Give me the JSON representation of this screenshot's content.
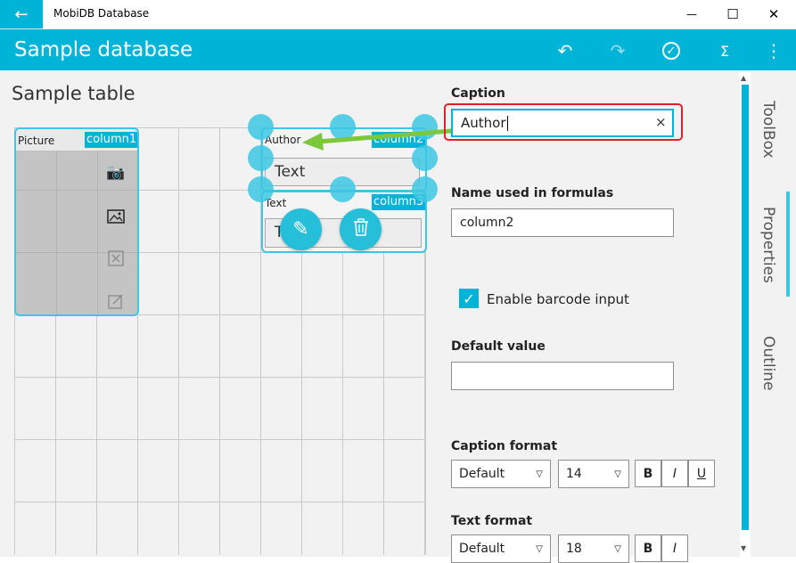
{
  "window": {
    "app_title": "MobiDB Database",
    "back_icon": "←",
    "minimize_icon": "—",
    "maximize_icon": "☐",
    "close_icon": "✕"
  },
  "header": {
    "title": "Sample database",
    "undo_icon": "↶",
    "redo_icon": "↷",
    "check_icon": "✓",
    "formula_icon": "Σ",
    "more_icon": "⋮",
    "color": "#00b4d8"
  },
  "table": {
    "title": "Sample table",
    "column1": {
      "label": "Picture",
      "tag": "column1"
    },
    "column2": {
      "label": "Author",
      "tag": "column2",
      "field_text": "Text"
    },
    "column3": {
      "label": "Text",
      "tag": "column3",
      "field_text": "T"
    },
    "edit_icon": "✎",
    "delete_icon": "🗑"
  },
  "properties": {
    "caption_label": "Caption",
    "caption_value": "Author",
    "clear_icon": "×",
    "formula_name_label": "Name used in formulas",
    "formula_name_value": "column2",
    "barcode_checked": true,
    "barcode_label": "Enable barcode input",
    "default_value_label": "Default value",
    "default_value": "",
    "caption_format_label": "Caption format",
    "caption_format_style": "Default",
    "caption_format_size": "14",
    "text_format_label": "Text format",
    "text_format_style": "Default",
    "text_format_size": "18",
    "bold": "B",
    "italic": "I",
    "underline": "U"
  },
  "side_tabs": [
    "ToolBox",
    "Properties",
    "Outline"
  ],
  "colors": {
    "accent": "#00b4d8",
    "highlight_box": "#e0202a",
    "arrow": "#7dc73c"
  }
}
